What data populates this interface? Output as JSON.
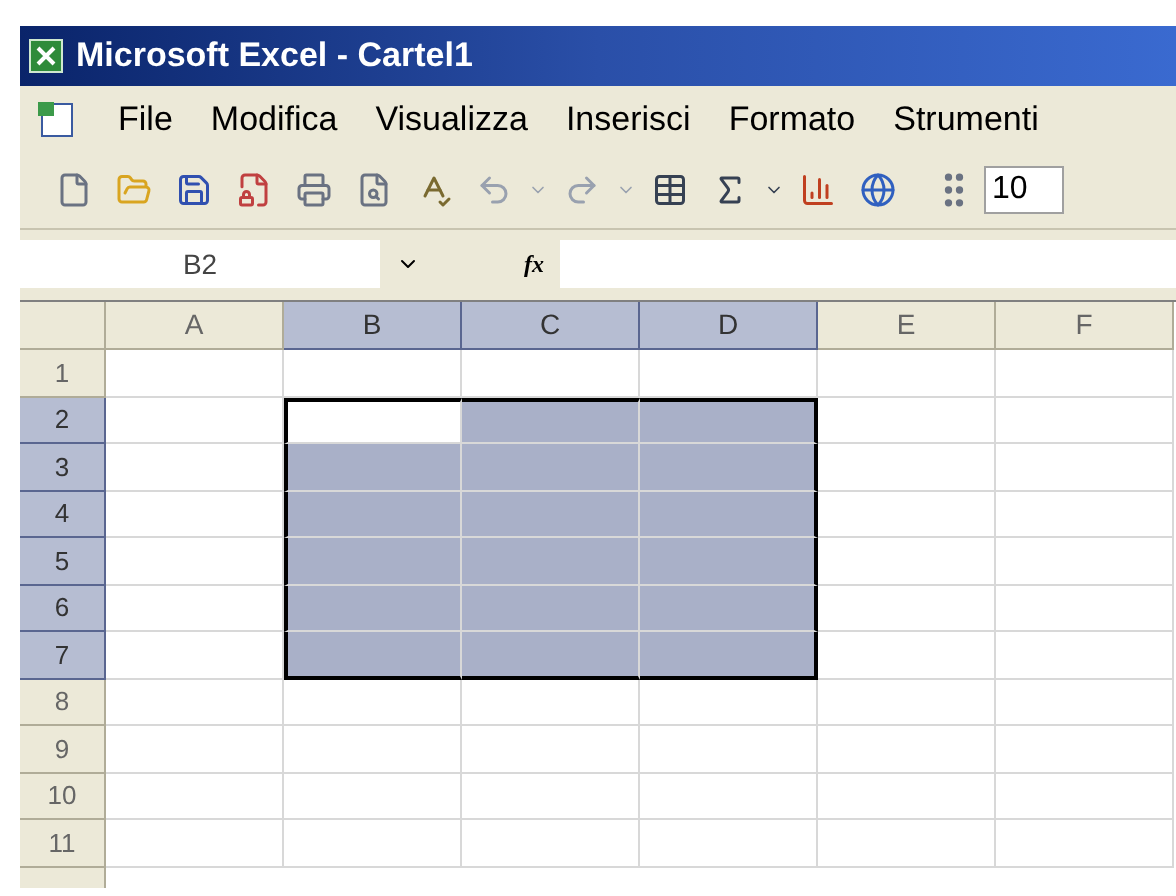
{
  "window": {
    "title": "Microsoft Excel - Cartel1"
  },
  "menu": [
    "File",
    "Modifica",
    "Visualizza",
    "Inserisci",
    "Formato",
    "Strumenti"
  ],
  "toolbar": {
    "font_size": "10"
  },
  "formula_bar": {
    "name_box": "B2",
    "fx": "fx"
  },
  "columns": [
    {
      "label": "A",
      "selected": false
    },
    {
      "label": "B",
      "selected": true
    },
    {
      "label": "C",
      "selected": true
    },
    {
      "label": "D",
      "selected": true
    },
    {
      "label": "E",
      "selected": false
    },
    {
      "label": "F",
      "selected": false
    }
  ],
  "rows": [
    {
      "label": "1",
      "selected": false,
      "cells": [
        {
          "selected": false,
          "active": false
        },
        {
          "selected": false,
          "active": false
        },
        {
          "selected": false,
          "active": false
        },
        {
          "selected": false,
          "active": false
        },
        {
          "selected": false,
          "active": false
        },
        {
          "selected": false,
          "active": false
        }
      ]
    },
    {
      "label": "2",
      "selected": true,
      "cells": [
        {
          "selected": false,
          "active": false
        },
        {
          "selected": true,
          "active": true
        },
        {
          "selected": true,
          "active": false
        },
        {
          "selected": true,
          "active": false
        },
        {
          "selected": false,
          "active": false
        },
        {
          "selected": false,
          "active": false
        }
      ]
    },
    {
      "label": "3",
      "selected": true,
      "cells": [
        {
          "selected": false,
          "active": false
        },
        {
          "selected": true,
          "active": false
        },
        {
          "selected": true,
          "active": false
        },
        {
          "selected": true,
          "active": false
        },
        {
          "selected": false,
          "active": false
        },
        {
          "selected": false,
          "active": false
        }
      ]
    },
    {
      "label": "4",
      "selected": true,
      "cells": [
        {
          "selected": false,
          "active": false
        },
        {
          "selected": true,
          "active": false
        },
        {
          "selected": true,
          "active": false
        },
        {
          "selected": true,
          "active": false
        },
        {
          "selected": false,
          "active": false
        },
        {
          "selected": false,
          "active": false
        }
      ]
    },
    {
      "label": "5",
      "selected": true,
      "cells": [
        {
          "selected": false,
          "active": false
        },
        {
          "selected": true,
          "active": false
        },
        {
          "selected": true,
          "active": false
        },
        {
          "selected": true,
          "active": false
        },
        {
          "selected": false,
          "active": false
        },
        {
          "selected": false,
          "active": false
        }
      ]
    },
    {
      "label": "6",
      "selected": true,
      "cells": [
        {
          "selected": false,
          "active": false
        },
        {
          "selected": true,
          "active": false
        },
        {
          "selected": true,
          "active": false
        },
        {
          "selected": true,
          "active": false
        },
        {
          "selected": false,
          "active": false
        },
        {
          "selected": false,
          "active": false
        }
      ]
    },
    {
      "label": "7",
      "selected": true,
      "cells": [
        {
          "selected": false,
          "active": false
        },
        {
          "selected": true,
          "active": false
        },
        {
          "selected": true,
          "active": false
        },
        {
          "selected": true,
          "active": false
        },
        {
          "selected": false,
          "active": false
        },
        {
          "selected": false,
          "active": false
        }
      ]
    },
    {
      "label": "8",
      "selected": false,
      "cells": [
        {
          "selected": false,
          "active": false
        },
        {
          "selected": false,
          "active": false
        },
        {
          "selected": false,
          "active": false
        },
        {
          "selected": false,
          "active": false
        },
        {
          "selected": false,
          "active": false
        },
        {
          "selected": false,
          "active": false
        }
      ]
    },
    {
      "label": "9",
      "selected": false,
      "cells": [
        {
          "selected": false,
          "active": false
        },
        {
          "selected": false,
          "active": false
        },
        {
          "selected": false,
          "active": false
        },
        {
          "selected": false,
          "active": false
        },
        {
          "selected": false,
          "active": false
        },
        {
          "selected": false,
          "active": false
        }
      ]
    },
    {
      "label": "10",
      "selected": false,
      "cells": [
        {
          "selected": false,
          "active": false
        },
        {
          "selected": false,
          "active": false
        },
        {
          "selected": false,
          "active": false
        },
        {
          "selected": false,
          "active": false
        },
        {
          "selected": false,
          "active": false
        },
        {
          "selected": false,
          "active": false
        }
      ]
    },
    {
      "label": "11",
      "selected": false,
      "cells": [
        {
          "selected": false,
          "active": false
        },
        {
          "selected": false,
          "active": false
        },
        {
          "selected": false,
          "active": false
        },
        {
          "selected": false,
          "active": false
        },
        {
          "selected": false,
          "active": false
        },
        {
          "selected": false,
          "active": false
        }
      ]
    }
  ]
}
